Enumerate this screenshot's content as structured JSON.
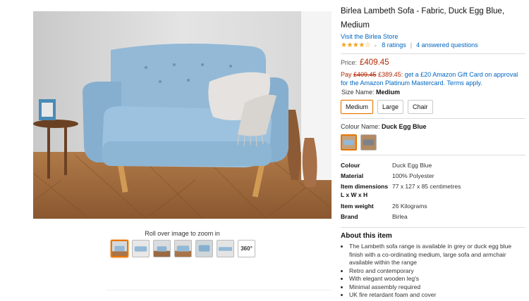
{
  "gallery": {
    "zoom_hint": "Roll over image to zoom in",
    "thumbnails": [
      {
        "name": "thumb-1",
        "selected": true
      },
      {
        "name": "thumb-2",
        "selected": false
      },
      {
        "name": "thumb-3",
        "selected": false
      },
      {
        "name": "thumb-4",
        "selected": false
      },
      {
        "name": "thumb-5",
        "selected": false
      },
      {
        "name": "thumb-6",
        "selected": false
      }
    ],
    "view_360_label": "360°"
  },
  "product": {
    "title": "Birlea Lambeth Sofa - Fabric, Duck Egg Blue, Medium",
    "store_link": "Visit the Birlea Store",
    "stars": "★★★★☆",
    "ratings": "8 ratings",
    "questions": "4 answered questions",
    "price_label": "Price:",
    "price": "£409.45",
    "promo_pay": "Pay",
    "promo_old": "£409.45",
    "promo_new": "£389.45:",
    "promo_text": "get a £20 Amazon Gift Card on approval for the Amazon Platinum Mastercard. Terms apply.",
    "size_label": "Size Name:",
    "size_selected": "Medium",
    "sizes": [
      "Medium",
      "Large",
      "Chair"
    ],
    "colour_label": "Colour Name:",
    "colour_selected": "Duck Egg Blue"
  },
  "specs": [
    {
      "key": "Colour",
      "value": "Duck Egg Blue"
    },
    {
      "key": "Material",
      "value": "100% Polyester"
    },
    {
      "key": "Item dimensions L x W x H",
      "value": "77 x 127 x 85 centimetres"
    },
    {
      "key": "Item weight",
      "value": "26 Kilograms"
    },
    {
      "key": "Brand",
      "value": "Birlea"
    }
  ],
  "about": {
    "title": "About this item",
    "bullets": [
      "The Lambeth sofa range is available in grey or duck egg blue finish with a co-ordinating medium, large sofa and armchair available within the range",
      "Retro and contemporary",
      "With elegant wooden leg's",
      "Minimal assembly required",
      "UK fire retardant foam and cover"
    ]
  },
  "colors": {
    "link": "#0066c0",
    "price": "#b12704",
    "star": "#f0a41c",
    "selected_border": "#e77600",
    "sofa": "#8fb8d8"
  }
}
